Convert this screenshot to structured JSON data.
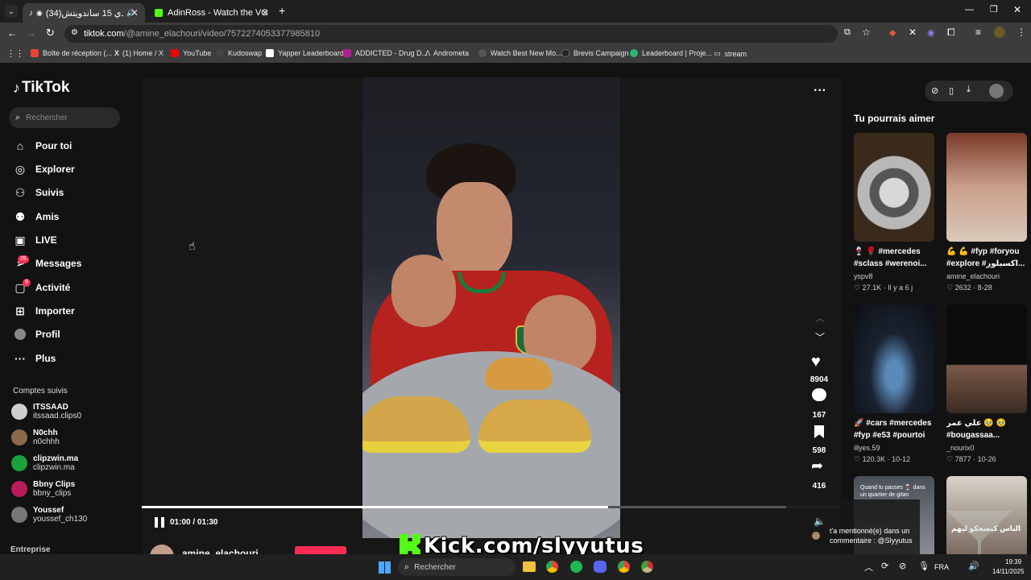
{
  "browser": {
    "tabs": [
      {
        "title": "(34)تحدي 15 ساندويتش",
        "active": true
      },
      {
        "title": "AdinRoss - Watch the VOD on",
        "active": false
      }
    ],
    "url_domain": "tiktok.com",
    "url_path": "/@amine_elachouri/video/7572274053377985810",
    "bookmarks": [
      "Boîte de réception (...",
      "(1) Home / X",
      "YouTube",
      "Kudoswap",
      "Yapper Leaderboard",
      "ADDICTED - Drug D...",
      "Andrometa",
      "Watch Best New Mo...",
      "Brevis Campaign",
      "Leaderboard | Proje...",
      "stream"
    ]
  },
  "tiktok": {
    "logo": "TikTok",
    "search_placeholder": "Rechercher",
    "nav": [
      {
        "label": "Pour toi",
        "icon": "home-icon"
      },
      {
        "label": "Explorer",
        "icon": "compass-icon"
      },
      {
        "label": "Suivis",
        "icon": "user-follow-icon"
      },
      {
        "label": "Amis",
        "icon": "friends-icon"
      },
      {
        "label": "LIVE",
        "icon": "live-icon"
      },
      {
        "label": "Messages",
        "icon": "messages-icon",
        "badge": "25"
      },
      {
        "label": "Activité",
        "icon": "activity-icon",
        "badge": "9"
      },
      {
        "label": "Importer",
        "icon": "upload-icon"
      },
      {
        "label": "Profil",
        "icon": "profile-icon"
      },
      {
        "label": "Plus",
        "icon": "more-icon"
      }
    ],
    "following_title": "Comptes suivis",
    "following": [
      {
        "name": "ITSSAAD",
        "user": "itssaad.clips0"
      },
      {
        "name": "N0chh",
        "user": "n0chhh"
      },
      {
        "name": "clipzwin.ma",
        "user": "clipzwin.ma"
      },
      {
        "name": "Bbny Clips",
        "user": "bbny_clips"
      },
      {
        "name": "Youssef",
        "user": "youssef_ch130"
      }
    ],
    "footer_label": "Entreprise"
  },
  "video": {
    "time": "01:00 / 01:30",
    "progress": 0.667,
    "likes": "8904",
    "comments": "167",
    "saves": "598",
    "shares": "416",
    "author_partial": "amine_elachouri",
    "overlay_text": "Kick.com/slyyutus"
  },
  "recommendations": {
    "title": "Tu pourrais aimer",
    "items": [
      {
        "caption1": "🍷 🌹 #mercedes",
        "caption2": "#sclass #werenoi...",
        "author": "yspv8",
        "likes": "27.1K",
        "date": "Il y a 6 j"
      },
      {
        "caption1": "💪 💪 #fyp #foryou",
        "caption2": "#explore #اكسبلور...",
        "author": "amine_elachouri",
        "likes": "2632",
        "date": "8-28"
      },
      {
        "caption1": "🚀 #cars #mercedes",
        "caption2": "#fyp #e53 #pourtoi",
        "author": "illyes.59",
        "likes": "120.3K",
        "date": "10-12"
      },
      {
        "caption1": "علي عمر 🥹 🥹",
        "caption2": "#bougassaa...",
        "author": "_nourix0",
        "likes": "7877",
        "date": "10-26"
      }
    ],
    "thumb5_text": "Quand tu passes 🍷 dans un quartier de gitan",
    "thumb6_text": "الناس كيضحكو ليهم"
  },
  "notification": {
    "text1": "t'a mentionné(e) dans un",
    "text2": "commentaire : @Slyyutus"
  },
  "taskbar": {
    "search": "Rechercher",
    "lang": "FRA",
    "time": "19:39",
    "date": "14/11/2025"
  }
}
